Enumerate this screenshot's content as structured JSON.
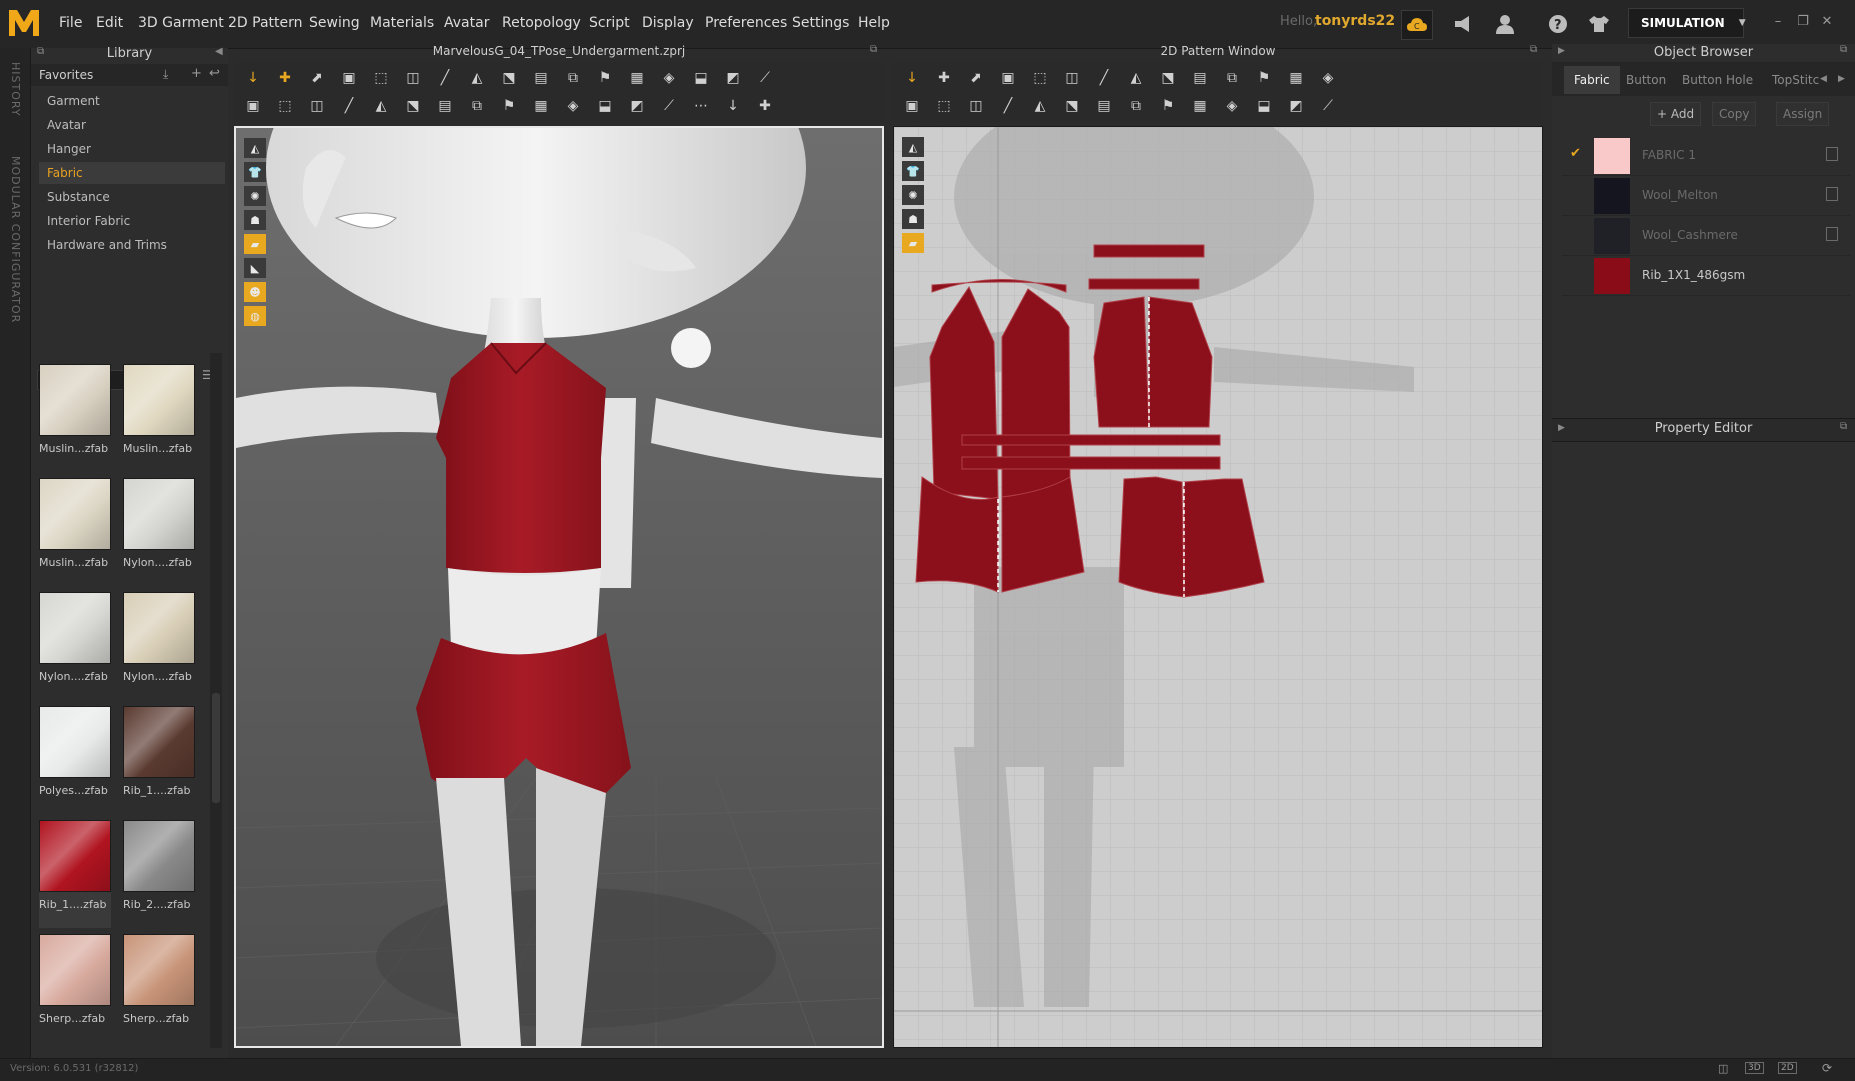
{
  "app": {
    "logo_text": "M",
    "version": "Version: 6.0.531 (r32812)"
  },
  "menubar": {
    "items": [
      "File",
      "Edit",
      "3D Garment",
      "2D Pattern",
      "Sewing",
      "Materials",
      "Avatar",
      "Retopology",
      "Script",
      "Display",
      "Preferences",
      "Settings",
      "Help"
    ],
    "hello": "Hello,",
    "username": "tonyrds22",
    "simulation_label": "SIMULATION"
  },
  "side_strip": {
    "history": "HISTORY",
    "modular": "MODULAR CONFIGURATOR"
  },
  "library": {
    "title": "Library",
    "favorites": "Favorites",
    "items": [
      "Garment",
      "Avatar",
      "Hanger",
      "Fabric",
      "Substance",
      "Interior Fabric",
      "Hardware and Trims"
    ],
    "active_index": 3,
    "thumbnails": [
      {
        "label": "Muslin...zfab",
        "color": "#d8d0c0"
      },
      {
        "label": "Muslin...zfab",
        "color": "#e0d8c0"
      },
      {
        "label": "Muslin...zfab",
        "color": "#dcd6c4"
      },
      {
        "label": "Nylon....zfab",
        "color": "#d4d4d0"
      },
      {
        "label": "Nylon....zfab",
        "color": "#d6d6d2"
      },
      {
        "label": "Nylon....zfab",
        "color": "#d8ceb6"
      },
      {
        "label": "Polyes...zfab",
        "color": "#e8eaea"
      },
      {
        "label": "Rib_1....zfab",
        "color": "#5a3a30"
      },
      {
        "label": "Rib_1....zfab",
        "color": "#b01420"
      },
      {
        "label": "Rib_2....zfab",
        "color": "#8a8a8a"
      },
      {
        "label": "Sherp...zfab",
        "color": "#d8aa9e"
      },
      {
        "label": "Sherp...zfab",
        "color": "#c89478"
      }
    ]
  },
  "viewport3d": {
    "file_title": "MarvelousG_04_TPose_Undergarment.zprj"
  },
  "pattern2d": {
    "title": "2D Pattern Window"
  },
  "object_browser": {
    "title": "Object Browser",
    "tabs": [
      "Fabric",
      "Button",
      "Button Hole",
      "TopStitc"
    ],
    "active_tab": 0,
    "buttons": [
      "+ Add",
      "Copy",
      "Assign"
    ],
    "fabrics": [
      {
        "name": "FABRIC 1",
        "color": "#f9c8c8",
        "checked": true,
        "dim": true
      },
      {
        "name": "Wool_Melton",
        "color": "#151520",
        "checked": false,
        "dim": true
      },
      {
        "name": "Wool_Cashmere",
        "color": "#202126",
        "checked": false,
        "dim": true
      },
      {
        "name": "Rib_1X1_486gsm",
        "color": "#8a0c18",
        "checked": false,
        "dim": false
      }
    ]
  },
  "property_editor": {
    "title": "Property Editor"
  },
  "colors": {
    "accent": "#e8a020",
    "garment_red": "#9c1520",
    "pattern_red": "#8c0f1c"
  }
}
